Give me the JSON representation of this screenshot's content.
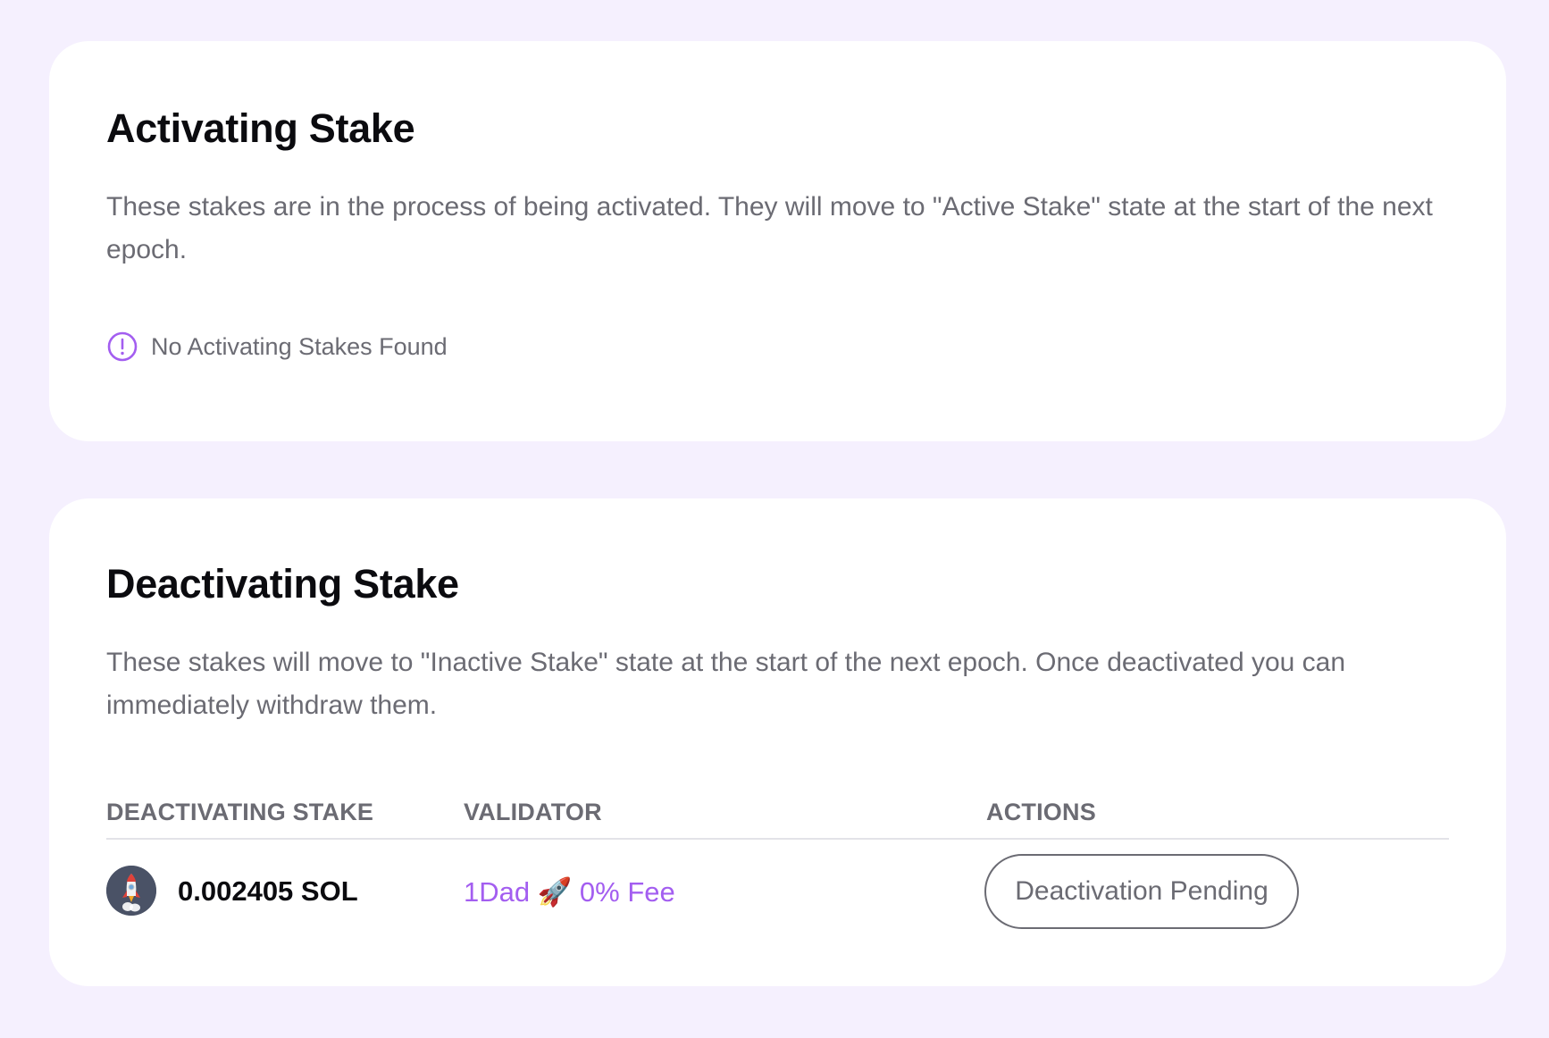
{
  "activating": {
    "title": "Activating Stake",
    "description": "These stakes are in the process of being activated. They will move to \"Active Stake\" state at the start of the next epoch.",
    "empty_message": "No Activating Stakes Found",
    "empty_icon": "alert-circle-icon"
  },
  "deactivating": {
    "title": "Deactivating Stake",
    "description": "These stakes will move to \"Inactive Stake\" state at the start of the next epoch. Once deactivated you can immediately withdraw them.",
    "columns": [
      "DEACTIVATING STAKE",
      "VALIDATOR",
      "ACTIONS"
    ],
    "rows": [
      {
        "avatar_icon": "rocket-icon",
        "amount": "0.002405 SOL",
        "validator": "1Dad 🚀 0% Fee",
        "action": "Deactivation Pending"
      }
    ]
  },
  "colors": {
    "background": "#f5f0fe",
    "card": "#ffffff",
    "accent": "#a35ef0",
    "muted_text": "#6b6b73",
    "heading_text": "#0b0b0f"
  }
}
